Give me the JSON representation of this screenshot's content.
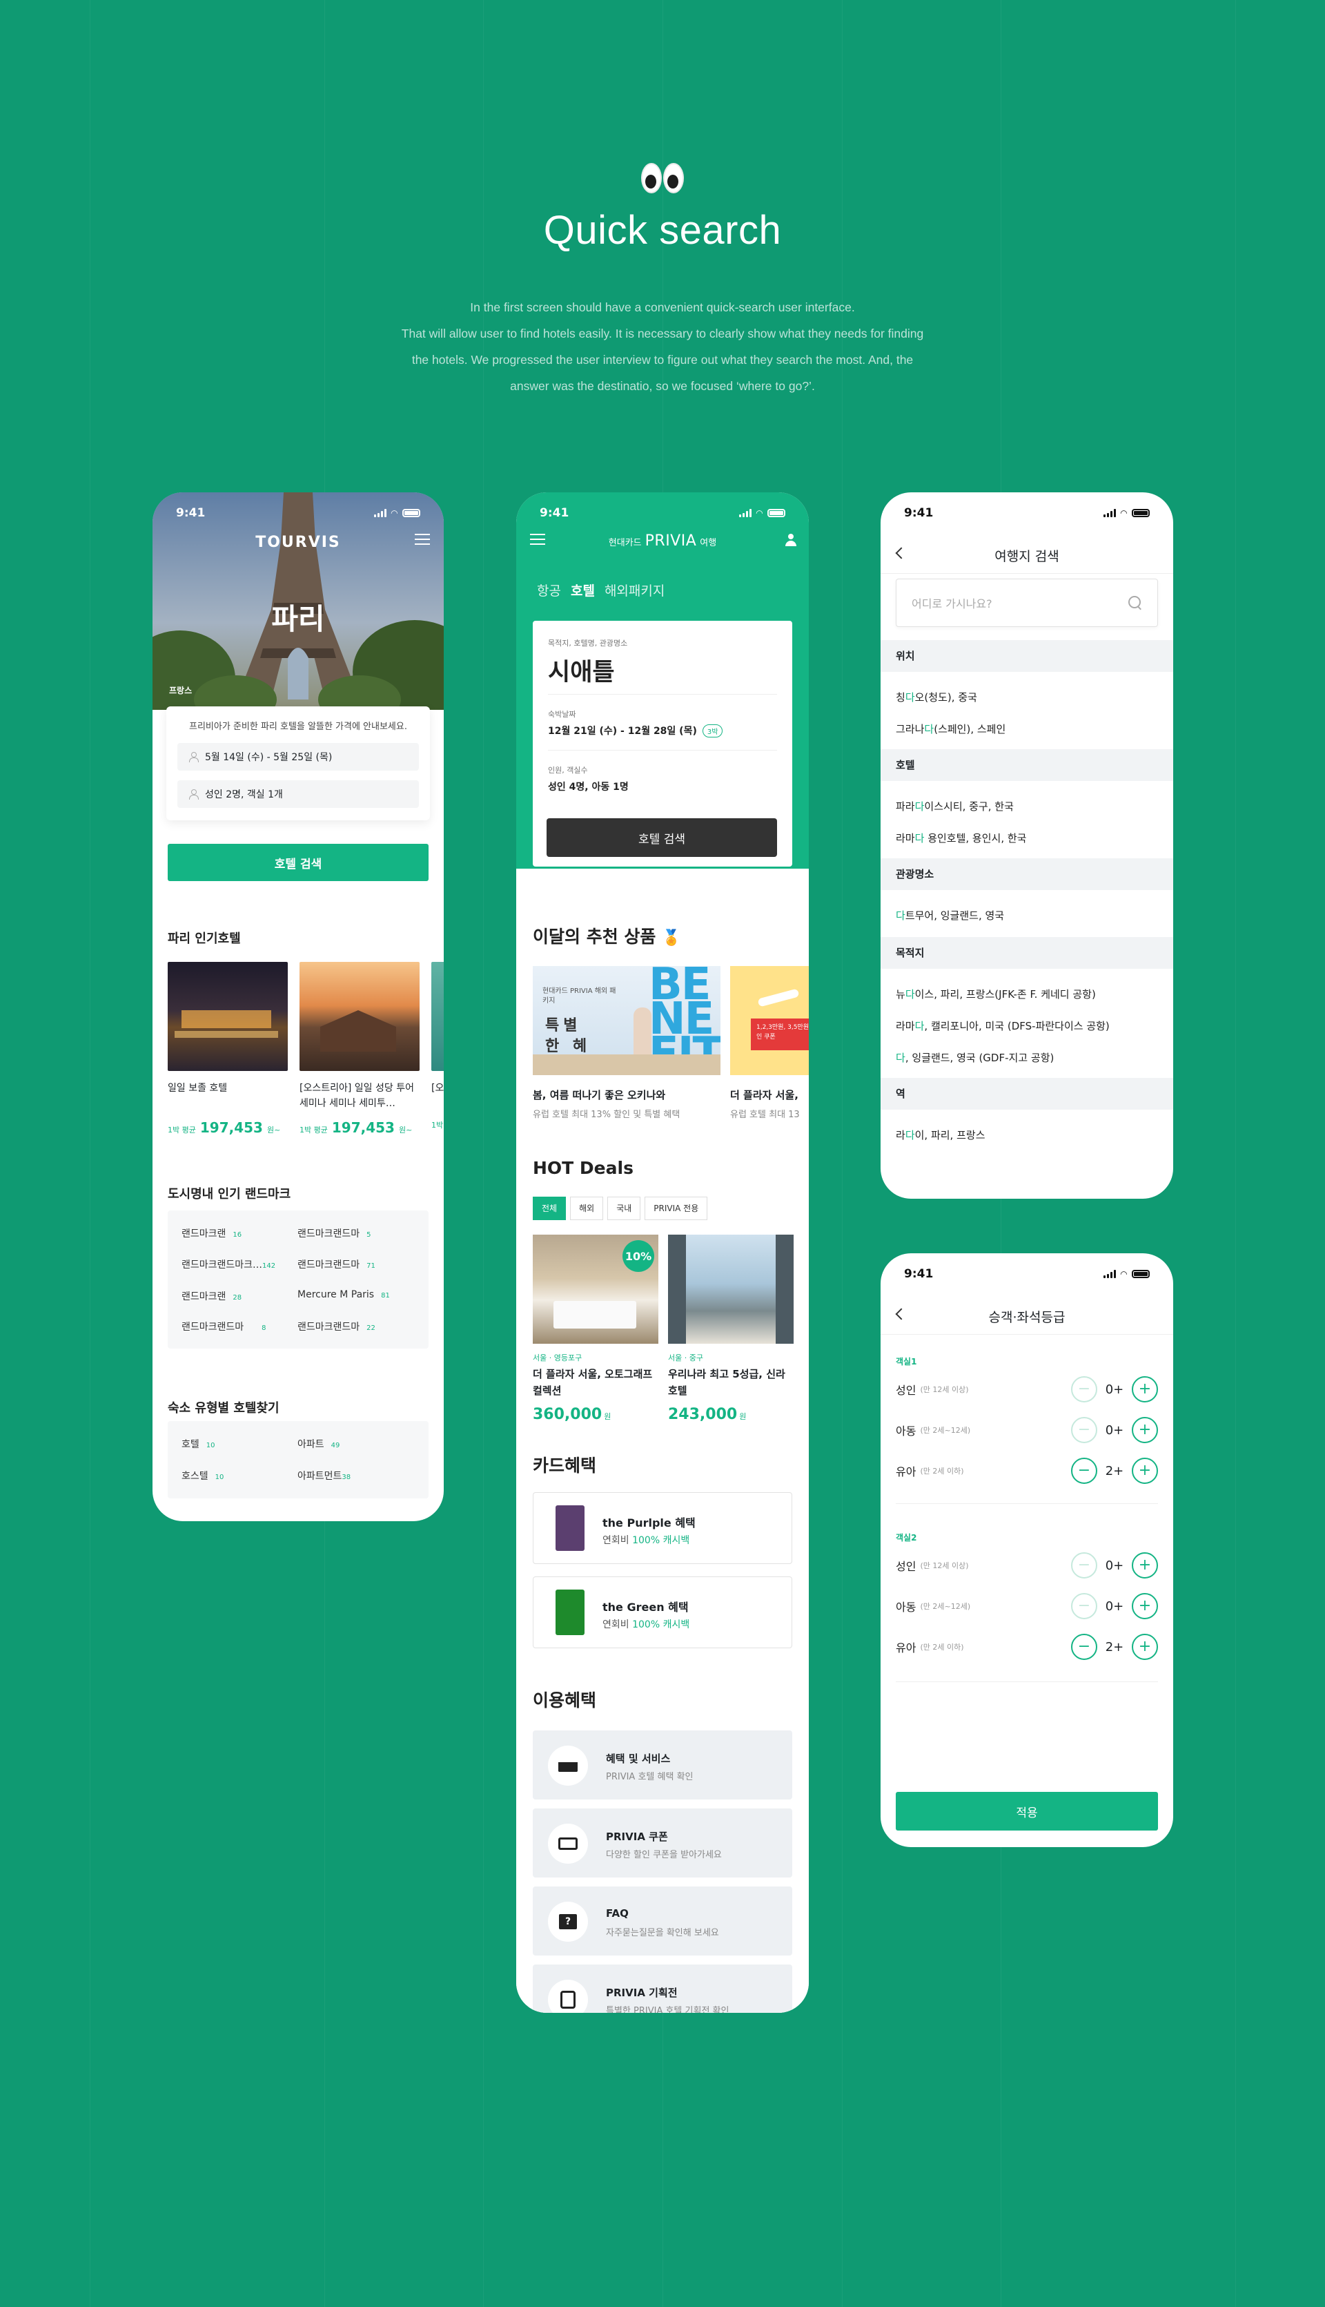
{
  "hero": {
    "title": "Quick search",
    "description": [
      "In the first screen should  have a convenient quick-search user interface.",
      "That will allow user to find hotels easily. It is necessary to clearly show what they needs for finding",
      "the hotels. We progressed the user interview to figure out what they search the most. And, the",
      "answer was the destinatio, so we focused ‘where to go?’."
    ]
  },
  "status_time": "9:41",
  "phone1": {
    "logo": "TOURVIS",
    "city": "파리",
    "country": "프랑스",
    "intro": "프리비아가 준비한 파리 호텔을 알뜰한 가격에 안내보세요.",
    "dates": "5월 14일 (수) - 5월 25일 (목)",
    "guests": "성인 2명, 객실 1개",
    "search_button": "호텔 검색",
    "popular_title": "파리 인기호텔",
    "hotels": [
      {
        "name": "일일 보졸 호텔",
        "price_label": "1박 평균",
        "price": "197,453",
        "unit": "원~"
      },
      {
        "name": "[오스트리아] 일일 성당 투어 세미나 세미나 세미투…",
        "price_label": "1박 평균",
        "price": "197,453",
        "unit": "원~"
      },
      {
        "name": "[오",
        "price_label": "1박",
        "price": "",
        "unit": ""
      }
    ],
    "landmark_title": "도시명내 인기 랜드마크",
    "landmarks": [
      {
        "name": "랜드마크랜",
        "count": "16"
      },
      {
        "name": "랜드마크랜드마",
        "count": "5"
      },
      {
        "name": "랜드마크랜드마크…",
        "count": "142"
      },
      {
        "name": "랜드마크랜드마",
        "count": "71"
      },
      {
        "name": "랜드마크랜",
        "count": "28"
      },
      {
        "name": "Mercure M Paris",
        "count": "81"
      },
      {
        "name": "랜드마크랜드마",
        "count": "8"
      },
      {
        "name": "랜드마크랜드마",
        "count": "22"
      }
    ],
    "type_title": "숙소 유형별 호텔찾기",
    "types": [
      {
        "name": "호텔",
        "count": "10"
      },
      {
        "name": "아파트",
        "count": "49"
      },
      {
        "name": "호스텔",
        "count": "10"
      },
      {
        "name": "아파트먼트",
        "count": "38"
      }
    ]
  },
  "phone2": {
    "logo_pre": "현대카드",
    "logo_main": "PRIVIA",
    "logo_post": "여행",
    "tabs": [
      "항공",
      "호텔",
      "해외패키지"
    ],
    "dest_label": "목적지, 호텔명, 관광명소",
    "dest_value": "시애틀",
    "date_label": "숙박날짜",
    "date_value": "12월 21일 (수) - 12월 28일 (목)",
    "nights": "3박",
    "guest_label": "인원, 객실수",
    "guest_value": "성인 4명, 아동 1명",
    "search_button": "호텔 검색",
    "recommend_title": "이달의 추천 상품",
    "recommend_emoji": "🏅",
    "promo_badge": "현대카드 PRIVIA 해외 패키지",
    "promo_text": "특별한 혜택",
    "promo_big": "BENEFIT",
    "promo2_tag": "1,2,3만원, 3,5만원 할인 쿠폰",
    "recommends": [
      {
        "title": "봄, 여름 떠나기 좋은 오키나와",
        "sub": "유럽 호텔 최대 13% 할인 및 특별 혜택"
      },
      {
        "title": "더 플라자 서울,",
        "sub": "유럽 호텔 최대 13"
      }
    ],
    "hot_title": "HOT Deals",
    "hot_filters": [
      "전체",
      "해외",
      "국내",
      "PRIVIA 전용"
    ],
    "discount_badge": "10%",
    "deals": [
      {
        "location": "서울 · 영등포구",
        "name": "더 플라자 서울, 오토그래프 컬렉션",
        "price": "360,000",
        "unit": "원"
      },
      {
        "location": "서울 · 중구",
        "name": "우리나라 최고 5성급, 신라호텔",
        "price": "243,000",
        "unit": "원"
      }
    ],
    "card_title": "카드혜택",
    "cards": [
      {
        "name": "the Purlple 혜택",
        "fee": "연회비",
        "cashback": "100% 캐시백",
        "color": "#5b3f6f"
      },
      {
        "name": "the Green 혜택",
        "fee": "연회비",
        "cashback": "100% 캐시백",
        "color": "#1e8a2c"
      }
    ],
    "benefit_title": "이용혜택",
    "benefits": [
      {
        "title": "혜택 및 서비스",
        "sub": "PRIVIA 호텔 혜택 확인",
        "icon": "card-icon"
      },
      {
        "title": "PRIVIA 쿠폰",
        "sub": "다양한 할인 쿠폰을 받아가세요",
        "icon": "coupon-icon"
      },
      {
        "title": "FAQ",
        "sub": "자주묻는질문을 확인해 보세요",
        "icon": "faq-icon"
      },
      {
        "title": "PRIVIA 기획전",
        "sub": "특별한 PRIVIA 호텔 기획전 확인",
        "icon": "event-icon"
      }
    ]
  },
  "phone3": {
    "title": "여행지 검색",
    "placeholder": "어디로 가시나요?",
    "sections": [
      {
        "name": "위치",
        "items": [
          [
            "칭",
            "다",
            "오(청도), 중국"
          ],
          [
            "그라나",
            "다",
            "(스페인), 스페인"
          ]
        ]
      },
      {
        "name": "호텔",
        "items": [
          [
            "파라",
            "다",
            "이스시티, 중구, 한국"
          ],
          [
            "라마",
            "다",
            " 용인호텔, 용인시, 한국"
          ]
        ]
      },
      {
        "name": "관광명소",
        "items": [
          [
            "",
            "다",
            "트무어, 잉글랜드, 영국"
          ]
        ]
      },
      {
        "name": "목적지",
        "items": [
          [
            "뉴",
            "다",
            "이스, 파리, 프랑스(JFK-존 F. 케네디 공항)"
          ],
          [
            "라마",
            "다",
            ", 캘리포니아, 미국 (DFS-파란다이스 공항)"
          ],
          [
            "",
            "다",
            ", 잉글랜드, 영국 (GDF-지고 공항)"
          ]
        ]
      },
      {
        "name": "역",
        "items": [
          [
            "라",
            "다",
            "이, 파리, 프랑스"
          ]
        ]
      }
    ]
  },
  "phone4": {
    "title": "승객·좌석등급",
    "rooms": [
      {
        "label": "객실1",
        "rows": [
          {
            "name": "성인",
            "age": "(만 12세 이상)",
            "value": "0+",
            "minus_enabled": false
          },
          {
            "name": "아동",
            "age": "(만 2세~12세)",
            "value": "0+",
            "minus_enabled": false
          },
          {
            "name": "유아",
            "age": "(만 2세 이하)",
            "value": "2+",
            "minus_enabled": true
          }
        ]
      },
      {
        "label": "객실2",
        "rows": [
          {
            "name": "성인",
            "age": "(만 12세 이상)",
            "value": "0+",
            "minus_enabled": false
          },
          {
            "name": "아동",
            "age": "(만 2세~12세)",
            "value": "0+",
            "minus_enabled": false
          },
          {
            "name": "유아",
            "age": "(만 2세 이하)",
            "value": "2+",
            "minus_enabled": true
          }
        ]
      }
    ],
    "apply_button": "적용"
  },
  "colors": {
    "background": "#0f9a72",
    "accent": "#14b484"
  }
}
